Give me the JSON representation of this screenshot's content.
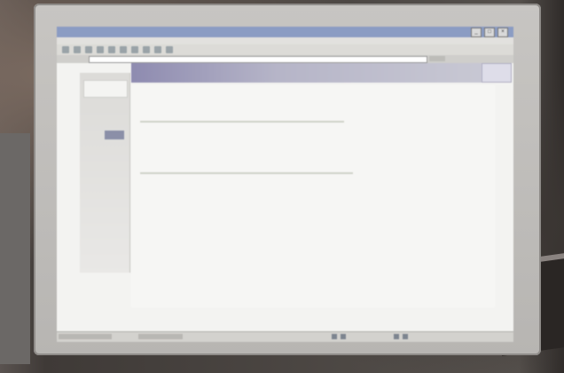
{
  "browser": {
    "title": "",
    "address_value": "",
    "window_buttons": [
      "_",
      "□",
      "×"
    ]
  },
  "page": {
    "banner_line1": "",
    "banner_line2": "",
    "login_box": "",
    "sidebar_tab": "",
    "sidebar_button": "",
    "content_heading": "",
    "content_label": "",
    "content_text": ""
  },
  "caption": {
    "text": ""
  },
  "colors": {
    "titlebar": "#8b9cc3",
    "banner_start": "#8e8bb0",
    "banner_end": "#c9c9d4",
    "sidebar_button": "#8b8fa8"
  }
}
